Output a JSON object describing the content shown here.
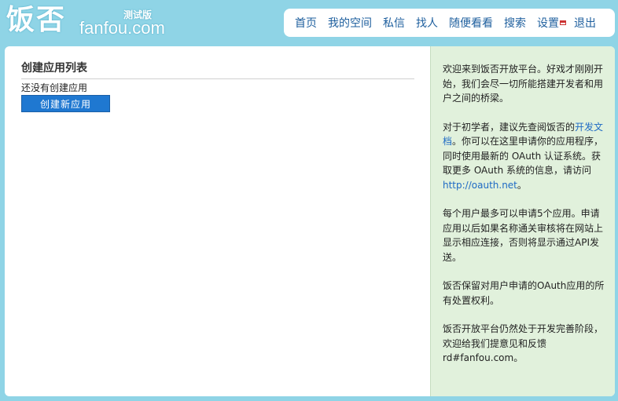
{
  "logo": {
    "text_cn": "饭否",
    "text_en": "fanfou.com",
    "badge": "测试版"
  },
  "nav": {
    "items": [
      {
        "label": "首页"
      },
      {
        "label": "我的空间"
      },
      {
        "label": "私信"
      },
      {
        "label": "找人"
      },
      {
        "label": "随便看看"
      },
      {
        "label": "搜索"
      },
      {
        "label": "设置"
      },
      {
        "label": "退出"
      }
    ]
  },
  "main": {
    "title": "创建应用列表",
    "empty_text": "还没有创建应用",
    "create_button": "创建新应用"
  },
  "sidebar": {
    "p1": "欢迎来到饭否开放平台。好戏才刚刚开始，我们会尽一切所能搭建开发者和用户之间的桥梁。",
    "p2_before": "对于初学者，建议先查阅饭否的",
    "p2_link": "开发文档",
    "p2_middle": "。你可以在这里申请你的应用程序，同时使用最新的 OAuth 认证系统。获取更多 OAuth 系统的信息，请访问 ",
    "p2_link2": "http://oauth.net",
    "p2_after": "。",
    "p3": "每个用户最多可以申请5个应用。申请应用以后如果名称通关审核将在网站上显示相应连接，否则将显示通过API发送。",
    "p4": "饭否保留对用户申请的OAuth应用的所有处置权利。",
    "p5": "饭否开放平台仍然处于开发完善阶段，欢迎给我们提意见和反馈 rd#fanfou.com。"
  }
}
